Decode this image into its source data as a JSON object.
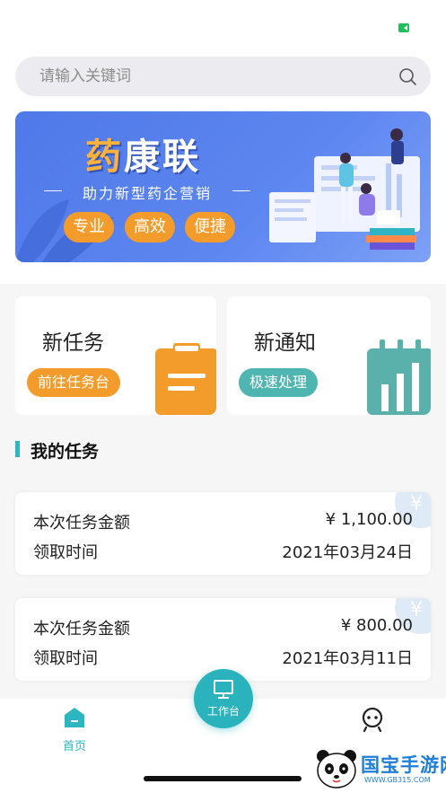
{
  "search": {
    "placeholder": "请输入关键词"
  },
  "banner": {
    "title_part1": "药",
    "title_part2": "康联",
    "subtitle": "助力新型药企营销",
    "tags": [
      "专业",
      "高效",
      "便捷"
    ]
  },
  "cards": [
    {
      "title": "新任务",
      "button": "前往任务台",
      "button_color": "#f39c2b",
      "icon": "clipboard-icon"
    },
    {
      "title": "新通知",
      "button": "极速处理",
      "button_color": "#4fb5b1",
      "icon": "bar-chart-icon"
    }
  ],
  "section": {
    "title": "我的任务"
  },
  "tasks": [
    {
      "amount_label": "本次任务金额",
      "amount": "¥ 1,100.00",
      "time_label": "领取时间",
      "time": "2021年03月24日"
    },
    {
      "amount_label": "本次任务金额",
      "amount": "¥ 800.00",
      "time_label": "领取时间",
      "time": "2021年03月11日"
    }
  ],
  "yen_symbol": "¥",
  "nav": {
    "home": "首页",
    "workbench": "工作台"
  },
  "watermark": {
    "name": "国宝手游网",
    "url": "WWW.GB315.COM"
  },
  "colors": {
    "accent": "#2bb6c0",
    "orange": "#f39c2b",
    "banner_blue": "#5d86f0"
  }
}
